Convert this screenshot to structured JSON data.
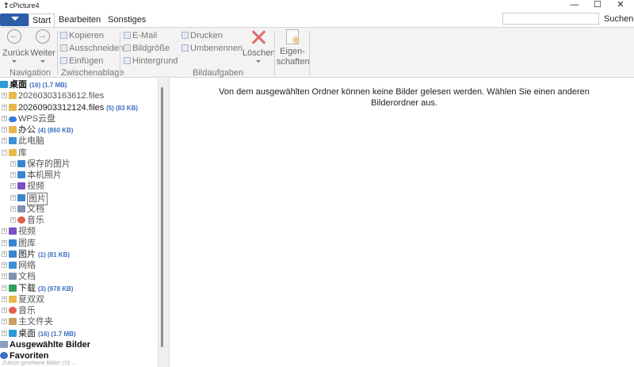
{
  "window": {
    "title": "cPicture4",
    "minimize": "—",
    "maximize": "☐",
    "close": "✕"
  },
  "tabs": [
    {
      "label": "Start",
      "active": true
    },
    {
      "label": "Bearbeiten",
      "active": false
    },
    {
      "label": "Sonstiges",
      "active": false
    }
  ],
  "search": {
    "value": "",
    "label": "Suchen"
  },
  "ribbon": {
    "navigation": {
      "label": "Navigation",
      "back": "Zurück",
      "forward": "Weiter"
    },
    "clipboard": {
      "label": "Zwischenablage",
      "copy": "Kopieren",
      "cut": "Ausschneiden",
      "paste": "Einfügen"
    },
    "image_tasks": {
      "label": "Bildaufgaben",
      "email": "E-Mail",
      "image_size": "Bildgröße",
      "background": "Hintergrund",
      "print": "Drucken",
      "rename": "Umbenennen",
      "delete": "Löschen",
      "properties_1": "Eigen-",
      "properties_2": "schaften"
    }
  },
  "tree": [
    {
      "label": "桌面",
      "count": "(16) (1.7 MB)",
      "indent": 0,
      "expander": "",
      "icon": "desktop-icon",
      "style": "bold"
    },
    {
      "label": "20260303163612.files",
      "count": "",
      "indent": 1,
      "expander": "+",
      "icon": "folder-icon",
      "style": ""
    },
    {
      "label": "20260903312124.files",
      "count": "(5) (83 KB)",
      "indent": 1,
      "expander": "+",
      "icon": "folder-icon",
      "style": "dark"
    },
    {
      "label": "WPS云盘",
      "count": "",
      "indent": 1,
      "expander": "+",
      "icon": "cloud-icon",
      "style": ""
    },
    {
      "label": "办公",
      "count": "(4) (860 KB)",
      "indent": 1,
      "expander": "+",
      "icon": "folder-icon",
      "style": "dark"
    },
    {
      "label": "此电脑",
      "count": "",
      "indent": 1,
      "expander": "+",
      "icon": "computer-icon",
      "style": ""
    },
    {
      "label": "库",
      "count": "",
      "indent": 1,
      "expander": "−",
      "icon": "folder-icon",
      "style": ""
    },
    {
      "label": "保存的图片",
      "count": "",
      "indent": 2,
      "expander": "+",
      "icon": "pictures-icon",
      "style": ""
    },
    {
      "label": "本机照片",
      "count": "",
      "indent": 2,
      "expander": "+",
      "icon": "pictures-icon",
      "style": ""
    },
    {
      "label": "视频",
      "count": "",
      "indent": 2,
      "expander": "+",
      "icon": "video-icon",
      "style": ""
    },
    {
      "label": "图片",
      "count": "",
      "indent": 2,
      "expander": "+",
      "icon": "pictures-icon",
      "style": "selected"
    },
    {
      "label": "文档",
      "count": "",
      "indent": 2,
      "expander": "+",
      "icon": "documents-icon",
      "style": ""
    },
    {
      "label": "音乐",
      "count": "",
      "indent": 2,
      "expander": "+",
      "icon": "music-icon",
      "style": ""
    },
    {
      "label": "视频",
      "count": "",
      "indent": 1,
      "expander": "+",
      "icon": "video-icon",
      "style": ""
    },
    {
      "label": "图库",
      "count": "",
      "indent": 1,
      "expander": "+",
      "icon": "pictures-icon",
      "style": ""
    },
    {
      "label": "图片",
      "count": "(1) (81 KB)",
      "indent": 1,
      "expander": "+",
      "icon": "pictures-icon",
      "style": "dark"
    },
    {
      "label": "网络",
      "count": "",
      "indent": 1,
      "expander": "+",
      "icon": "network-icon",
      "style": ""
    },
    {
      "label": "文档",
      "count": "",
      "indent": 1,
      "expander": "+",
      "icon": "documents-icon",
      "style": ""
    },
    {
      "label": "下载",
      "count": "(3) (978 KB)",
      "indent": 1,
      "expander": "+",
      "icon": "download-icon",
      "style": "dark"
    },
    {
      "label": "夏双双",
      "count": "",
      "indent": 1,
      "expander": "+",
      "icon": "folder-icon",
      "style": ""
    },
    {
      "label": "音乐",
      "count": "",
      "indent": 1,
      "expander": "+",
      "icon": "music-icon",
      "style": ""
    },
    {
      "label": "主文件夹",
      "count": "",
      "indent": 1,
      "expander": "+",
      "icon": "home-icon",
      "style": ""
    },
    {
      "label": "桌面",
      "count": "(16) (1.7 MB)",
      "indent": 1,
      "expander": "+",
      "icon": "desktop-icon",
      "style": "dark"
    },
    {
      "label": "Ausgewählte Bilder",
      "count": "",
      "indent": 0,
      "expander": "",
      "icon": "selected-images-icon",
      "style": "bold"
    },
    {
      "label": "Favoriten",
      "count": "",
      "indent": 0,
      "expander": "",
      "icon": "favorites-icon",
      "style": "bold"
    }
  ],
  "icon_colors": {
    "desktop-icon": "#2b9bd8",
    "folder-icon": "#e8b84a",
    "cloud-icon": "#2f7fe0",
    "computer-icon": "#3d8fd6",
    "pictures-icon": "#3a86d0",
    "video-icon": "#7a4fc8",
    "documents-icon": "#7f93b0",
    "music-icon": "#e0604a",
    "network-icon": "#3d8fd6",
    "download-icon": "#2f9f5a",
    "home-icon": "#c9a060",
    "selected-images-icon": "#8aa0c0",
    "favorites-icon": "#3a6fc4"
  },
  "main": {
    "message": "Von dem ausgewählten Ordner können keine Bilder gelesen werden. Wählen Sie einen anderen Bilderordner aus."
  },
  "footer": {
    "partial_text": "Zuletzt gesehene Bilder (15 ..."
  }
}
